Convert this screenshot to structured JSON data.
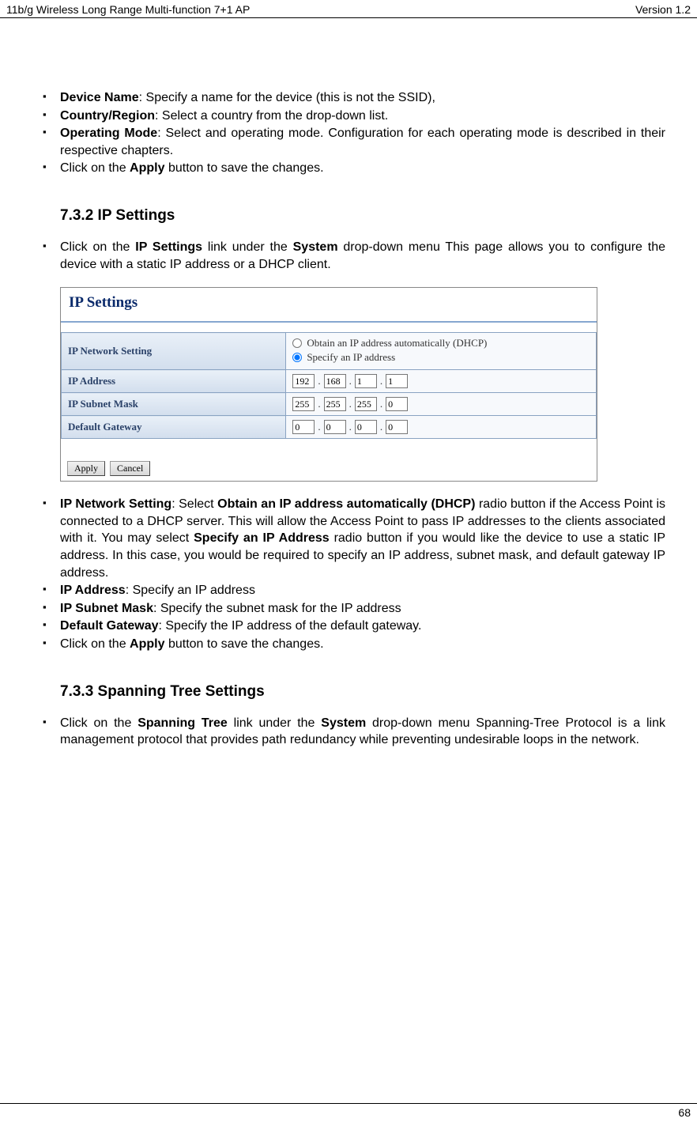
{
  "header": {
    "left": "11b/g Wireless Long Range Multi-function 7+1 AP",
    "right": "Version 1.2"
  },
  "bullets_top": {
    "device_name": {
      "label": "Device Name",
      "desc": ": Specify a name for the device (this is not the SSID),"
    },
    "country": {
      "label": "Country/Region",
      "desc": ": Select a country from the drop-down list."
    },
    "op_mode": {
      "label": "Operating Mode",
      "desc": ": Select and operating mode. Configuration for each operating mode is described in their respective chapters."
    },
    "apply": {
      "prefix": "Click on the ",
      "bold": "Apply",
      "suffix": " button to save the changes."
    }
  },
  "section_ip": {
    "heading": "7.3.2   IP Settings",
    "intro": {
      "p1": "Click on the ",
      "b1": "IP Settings",
      "p2": " link under the ",
      "b2": "System",
      "p3": " drop-down menu This page allows you to configure the device with a static IP address or a DHCP client."
    }
  },
  "figure": {
    "title": "IP Settings",
    "rows": {
      "network_setting": "IP Network Setting",
      "ip_addr": "IP Address",
      "subnet": "IP Subnet Mask",
      "gateway": "Default Gateway"
    },
    "radios": {
      "dhcp": "Obtain an IP address automatically (DHCP)",
      "specify": "Specify an IP address",
      "selected": "specify"
    },
    "values": {
      "ip": [
        "192",
        "168",
        "1",
        "1"
      ],
      "mask": [
        "255",
        "255",
        "255",
        "0"
      ],
      "gw": [
        "0",
        "0",
        "0",
        "0"
      ]
    },
    "buttons": {
      "apply": "Apply",
      "cancel": "Cancel"
    }
  },
  "bullets_mid": {
    "ip_net": {
      "label": "IP Network Setting",
      "p1": ": Select ",
      "b1": "Obtain an IP address automatically (DHCP)",
      "p2": " radio button if the Access Point is connected to a DHCP server. This will allow the Access Point to pass IP addresses to the clients associated with it. You may select ",
      "b2": "Specify an IP Address",
      "p3": " radio button if you would like the device to use a static IP address. In this case, you would be required to specify an IP address, subnet mask, and default gateway IP address."
    },
    "ip_addr": {
      "label": "IP Address",
      "desc": ": Specify an IP address"
    },
    "ip_subnet": {
      "label": "IP Subnet Mask",
      "desc": ": Specify the subnet mask for the IP address"
    },
    "def_gw": {
      "label": "Default Gateway",
      "desc": ": Specify the IP address of the default gateway."
    },
    "apply2": {
      "prefix": "Click on the ",
      "bold": "Apply",
      "suffix": " button to save the changes."
    }
  },
  "section_stp": {
    "heading": "7.3.3   Spanning Tree Settings",
    "intro": {
      "p1": "Click on the ",
      "b1": "Spanning Tree",
      "p2": " link under the ",
      "b2": "System",
      "p3": " drop-down menu Spanning-Tree Protocol is a link management protocol that provides path redundancy while preventing undesirable loops in the network."
    }
  },
  "page_number": "68"
}
